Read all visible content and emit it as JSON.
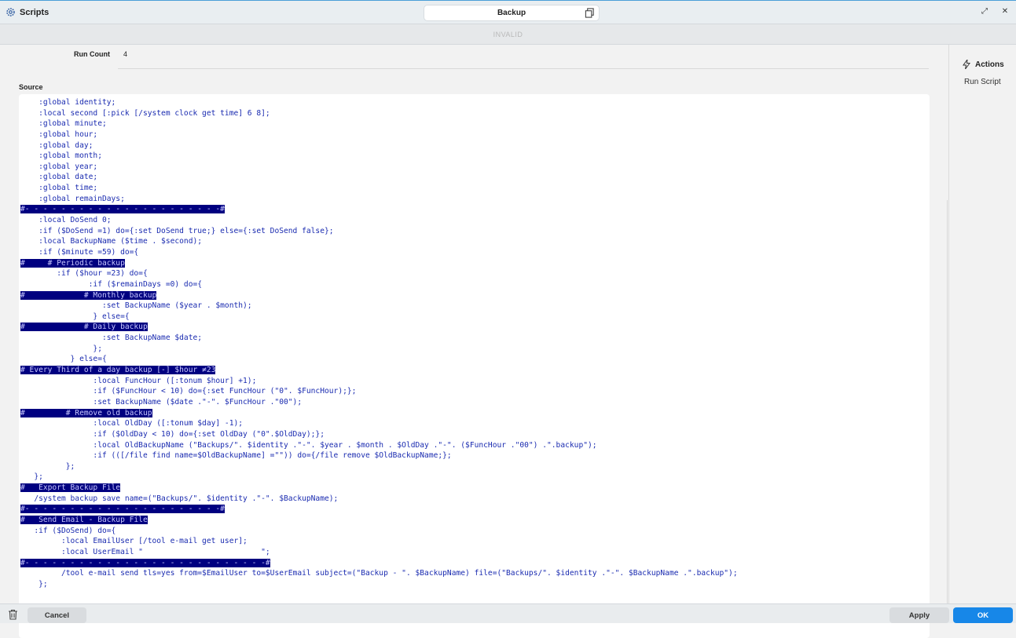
{
  "window": {
    "app_title": "Scripts",
    "document_title": "Backup",
    "status": "INVALID"
  },
  "fields": {
    "run_count_label": "Run Count",
    "run_count_value": "4",
    "source_label": "Source"
  },
  "sidebar": {
    "actions_title": "Actions",
    "items": [
      {
        "label": "Run Script"
      }
    ]
  },
  "source_lines": [
    {
      "text": "    :global identity;",
      "selected": false
    },
    {
      "text": "    :local second [:pick [/system clock get time] 6 8];",
      "selected": false
    },
    {
      "text": "    :global minute;",
      "selected": false
    },
    {
      "text": "    :global hour;",
      "selected": false
    },
    {
      "text": "    :global day;",
      "selected": false
    },
    {
      "text": "    :global month;",
      "selected": false
    },
    {
      "text": "    :global year;",
      "selected": false
    },
    {
      "text": "    :global date;",
      "selected": false
    },
    {
      "text": "    :global time;",
      "selected": false
    },
    {
      "text": "    :global remainDays;",
      "selected": false
    },
    {
      "text": "#- - - - - - - - - - - - - - - - - - - - - -#",
      "selected": true
    },
    {
      "text": "    :local DoSend 0;",
      "selected": false
    },
    {
      "text": "    :if ($DoSend =1) do={:set DoSend true;} else={:set DoSend false};",
      "selected": false
    },
    {
      "text": "    :local BackupName ($time . $second);",
      "selected": false
    },
    {
      "text": "    :if ($minute =59) do={",
      "selected": false
    },
    {
      "text": "#     # Periodic backup",
      "selected": true
    },
    {
      "text": "        :if ($hour =23) do={",
      "selected": false
    },
    {
      "text": "               :if ($remainDays =0) do={",
      "selected": false
    },
    {
      "text": "#             # Monthly backup",
      "selected": true
    },
    {
      "text": "                  :set BackupName ($year . $month);",
      "selected": false
    },
    {
      "text": "                } else={",
      "selected": false
    },
    {
      "text": "#             # Daily backup",
      "selected": true
    },
    {
      "text": "                  :set BackupName $date;",
      "selected": false
    },
    {
      "text": "                };",
      "selected": false
    },
    {
      "text": "           } else={",
      "selected": false
    },
    {
      "text": "# Every Third of a day backup [-] $hour ≠23",
      "selected": true
    },
    {
      "text": "                :local FuncHour ([:tonum $hour] +1);",
      "selected": false
    },
    {
      "text": "                :if ($FuncHour < 10) do={:set FuncHour (\"0\". $FuncHour);};",
      "selected": false
    },
    {
      "text": "                :set BackupName ($date .\"-\". $FuncHour .\"00\");",
      "selected": false
    },
    {
      "text": "#         # Remove old backup",
      "selected": true
    },
    {
      "text": "                :local OldDay ([:tonum $day] -1);",
      "selected": false
    },
    {
      "text": "                :if ($OldDay < 10) do={:set OldDay (\"0\".$OldDay);};",
      "selected": false
    },
    {
      "text": "                :local OldBackupName (\"Backups/\". $identity .\"-\". $year . $month . $OldDay .\"-\". ($FuncHour .\"00\") .\".backup\");",
      "selected": false
    },
    {
      "text": "                :if (([/file find name=$OldBackupName] =\"\")) do={/file remove $OldBackupName;};",
      "selected": false
    },
    {
      "text": "          };",
      "selected": false
    },
    {
      "text": "   };",
      "selected": false
    },
    {
      "text": "#   Export Backup File",
      "selected": true
    },
    {
      "text": "   /system backup save name=(\"Backups/\". $identity .\"-\". $BackupName);",
      "selected": false
    },
    {
      "text": "#- - - - - - - - - - - - - - - - - - - - - -#",
      "selected": true
    },
    {
      "text": "#   Send Email - Backup File",
      "selected": true
    },
    {
      "text": "   :if ($DoSend) do={",
      "selected": false
    },
    {
      "text": "         :local EmailUser [/tool e-mail get user];",
      "selected": false
    },
    {
      "text": "         :local UserEmail \"                          \";",
      "selected": false
    },
    {
      "text": "#- - - - - - - - - - - - - - - - - - - - - - - - - - -#",
      "selected": true
    },
    {
      "text": "         /tool e-mail send tls=yes from=$EmailUser to=$UserEmail subject=(\"Backup - \". $BackupName) file=(\"Backups/\". $identity .\"-\". $BackupName .\".backup\");",
      "selected": false
    },
    {
      "text": "    };",
      "selected": false
    }
  ],
  "footer": {
    "cancel_label": "Cancel",
    "apply_label": "Apply",
    "ok_label": "OK"
  },
  "icons": {
    "app": "gear-icon",
    "copy": "copy-icon",
    "restore": "restore-icon",
    "close": "close-icon",
    "actions": "lightning-icon",
    "delete": "trash-icon"
  },
  "colors": {
    "accent": "#1787e8",
    "selection": "#000080",
    "code_text": "#1a2bb0"
  }
}
